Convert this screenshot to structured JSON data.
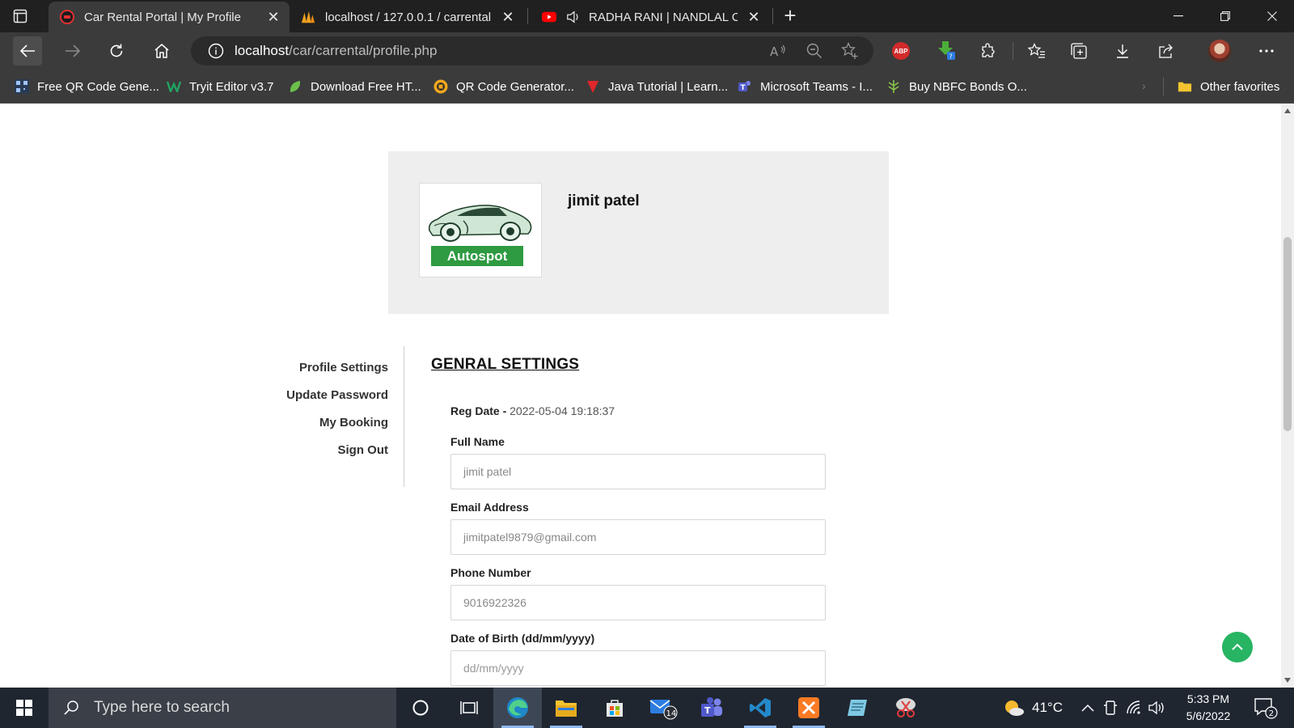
{
  "browser": {
    "tabs": [
      {
        "title": "Car Rental Portal | My Profile",
        "active": true
      },
      {
        "title": "localhost / 127.0.0.1 / carrental |",
        "active": false
      },
      {
        "title": "RADHA RANI | NANDLAL CH",
        "active": false
      }
    ],
    "address": {
      "host": "localhost",
      "path": "/car/carrental/profile.php"
    },
    "bookmarks": [
      {
        "label": "Free QR Code Gene..."
      },
      {
        "label": "Tryit Editor v3.7"
      },
      {
        "label": "Download Free HT..."
      },
      {
        "label": "QR Code Generator..."
      },
      {
        "label": "Java Tutorial | Learn..."
      },
      {
        "label": "Microsoft Teams - I..."
      },
      {
        "label": "Buy NBFC Bonds O..."
      }
    ],
    "other_favorites": "Other favorites",
    "abp_label": "ABP"
  },
  "page": {
    "logo_label": "Autospot",
    "user_name": "jimit patel",
    "nav": [
      {
        "label": "Profile Settings"
      },
      {
        "label": "Update Password"
      },
      {
        "label": "My Booking"
      },
      {
        "label": "Sign Out"
      }
    ],
    "settings": {
      "heading": "GENRAL SETTINGS",
      "reg_label": "Reg Date -",
      "reg_value": "2022-05-04 19:18:37",
      "full_name_label": "Full Name",
      "full_name_value": "jimit patel",
      "email_label": "Email Address",
      "email_value": "jimitpatel9879@gmail.com",
      "phone_label": "Phone Number",
      "phone_value": "9016922326",
      "dob_label": "Date of Birth (dd/mm/yyyy)",
      "dob_placeholder": "dd/mm/yyyy"
    }
  },
  "taskbar": {
    "search_placeholder": "Type here to search",
    "mail_badge": "14",
    "temperature": "41°C",
    "time": "5:33 PM",
    "date": "5/6/2022",
    "notification_count": "2"
  },
  "colors": {
    "brand_green": "#2e9a41",
    "scroll_top_green": "#27b463",
    "header_bg": "#eeeeee",
    "browser_dark": "#202020",
    "toolbar": "#3b3b3b"
  }
}
